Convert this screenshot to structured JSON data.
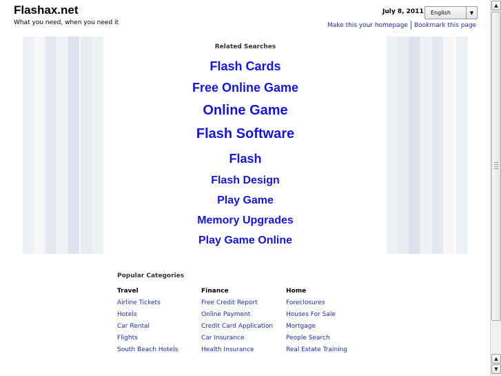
{
  "header": {
    "site_title": "Flashax.net",
    "tagline": "What you need, when you need it",
    "date": "July 8, 2011",
    "language": "English",
    "links": [
      "Make this your homepage",
      "Bookmark this page"
    ]
  },
  "related": {
    "title": "Related Searches",
    "links": [
      {
        "label": "Flash Cards",
        "size": "large"
      },
      {
        "label": "Free Online Game",
        "size": "large"
      },
      {
        "label": "Online Game",
        "size": "larger"
      },
      {
        "label": "Flash Software",
        "size": "larger"
      },
      {
        "label": "Flash",
        "size": "large"
      },
      {
        "label": "Flash Design",
        "size": "medium"
      },
      {
        "label": "Play Game",
        "size": "medium"
      },
      {
        "label": "Memory Upgrades",
        "size": "medium"
      },
      {
        "label": "Play Game Online",
        "size": "medium"
      }
    ],
    "link_color": "#1515e0"
  },
  "popular": {
    "title": "Popular Categories",
    "columns": [
      {
        "heading": "Travel",
        "items": [
          "Airline Tickets",
          "Hotels",
          "Car Rental",
          "Flights",
          "South Beach Hotels"
        ]
      },
      {
        "heading": "Finance",
        "items": [
          "Free Credit Report",
          "Online Payment",
          "Credit Card Application",
          "Car Insurance",
          "Health Insurance"
        ]
      },
      {
        "heading": "Home",
        "items": [
          "Foreclosures",
          "Houses For Sale",
          "Mortgage",
          "People Search",
          "Real Estate Training"
        ]
      }
    ]
  },
  "colors": {
    "link": "#1a2ec8",
    "stripes": [
      "#eef0f6",
      "#f7f7f7",
      "#e4e8f0",
      "#eef2f7",
      "#dde3ee",
      "#e9edf3",
      "#ebf4f2"
    ]
  },
  "icons": {
    "dropdown": "chevron-down-icon",
    "scroll_up": "arrow-up-icon",
    "scroll_down": "arrow-down-icon"
  }
}
